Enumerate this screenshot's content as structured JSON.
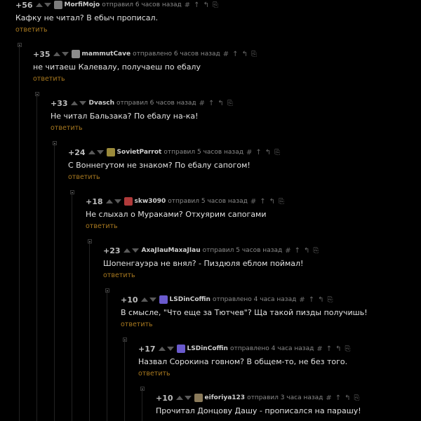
{
  "labels": {
    "reply": "ответить",
    "tools": [
      "#",
      "↑",
      "↰",
      "⎘"
    ]
  },
  "comments": [
    {
      "score": "+56",
      "author": "MorfiMojo",
      "posted": "отправил 6 часов назад",
      "text": "Кафку не читал? В ебыч прописал.",
      "avatar_color": "#7b7b7b"
    },
    {
      "score": "+35",
      "author": "mammutCave",
      "posted": "отправлено 6 часов назад",
      "text": "не читаеш Калевалу, получаеш по ебалу",
      "avatar_color": "#8c8c8c"
    },
    {
      "score": "+33",
      "author": "Dvasch",
      "posted": "отправил 6 часов назад",
      "text": "Не читал Бальзака? По ебалу на-ка!",
      "avatar_color": ""
    },
    {
      "score": "+24",
      "author": "SovietParrot",
      "posted": "отправил 5 часов назад",
      "text": "С Воннегутом не знаком? По ебалу сапогом!",
      "avatar_color": "#9b8a3a"
    },
    {
      "score": "+18",
      "author": "skw3090",
      "posted": "отправил 5 часов назад",
      "text": "Не слыхал о Мураками? Отхуярим сапогами",
      "avatar_color": "#b03a3a"
    },
    {
      "score": "+23",
      "author": "АхаJIauMaxaJIau",
      "posted": "отправил 5 часов назад",
      "text": "Шопенгауэра не внял? - Пиздюля еблом поймал!",
      "avatar_color": ""
    },
    {
      "score": "+10",
      "author": "LSDinCoffin",
      "posted": "отправлено 4 часа назад",
      "text": "В смысле, \"Что еще за Тютчев\"? Ща такой пизды получишь!",
      "avatar_color": "#6a5acd"
    },
    {
      "score": "+17",
      "author": "LSDinCoffin",
      "posted": "отправлено 4 часа назад",
      "text": "Назвал Сорокина говном? В общем-то, не без того.",
      "avatar_color": "#6a5acd"
    },
    {
      "score": "+10",
      "author": "eiforiya123",
      "posted": "отправил 3 часа назад",
      "text": "Прочитал Донцову Дашу - прописался на парашу!",
      "avatar_color": "#8a7a5a"
    }
  ]
}
